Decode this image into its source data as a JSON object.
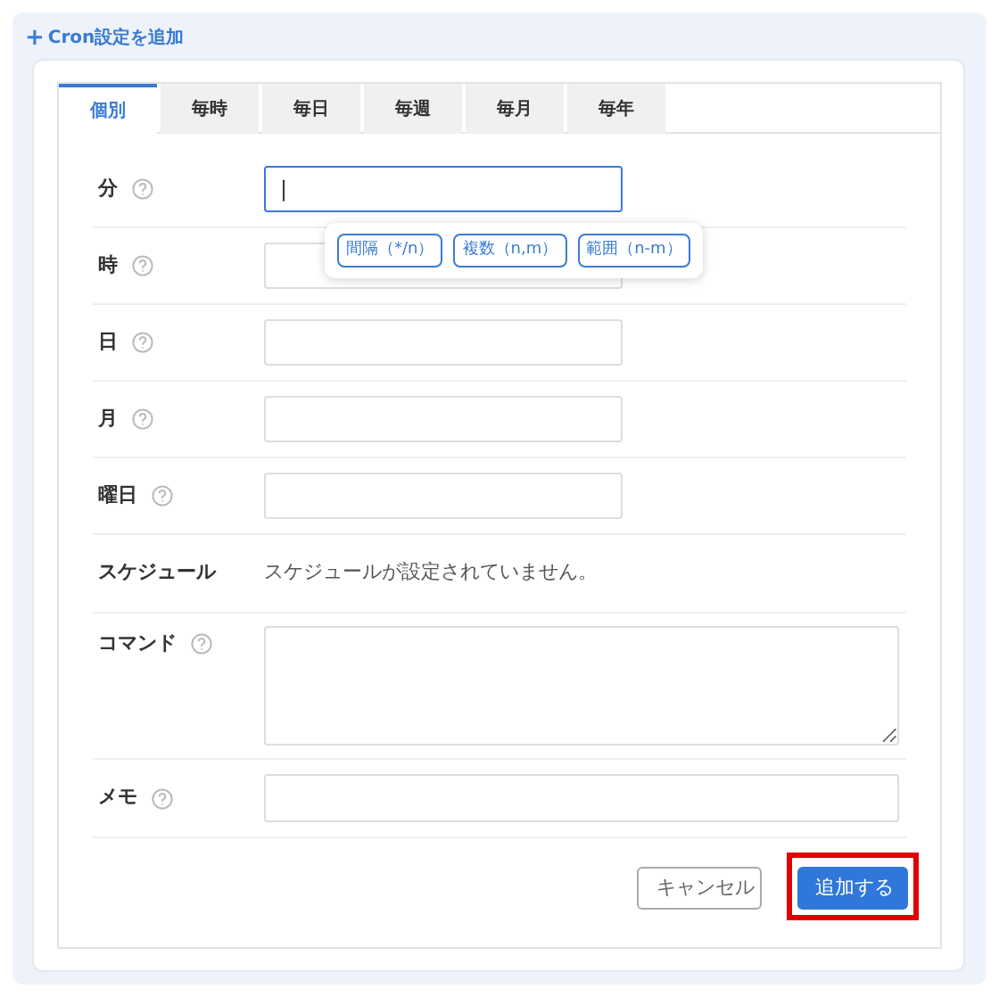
{
  "header": {
    "icon": "+",
    "title": "Cron設定を追加"
  },
  "tabs": [
    {
      "label": "個別",
      "selected": true
    },
    {
      "label": "毎時",
      "selected": false
    },
    {
      "label": "毎日",
      "selected": false
    },
    {
      "label": "毎週",
      "selected": false
    },
    {
      "label": "毎月",
      "selected": false
    },
    {
      "label": "毎年",
      "selected": false
    }
  ],
  "rows": [
    {
      "kind": "input",
      "label": "分",
      "help": true,
      "focused": true,
      "value": "|"
    },
    {
      "kind": "input",
      "label": "時",
      "help": true,
      "focused": false
    },
    {
      "kind": "input",
      "label": "日",
      "help": true,
      "focused": false
    },
    {
      "kind": "input",
      "label": "月",
      "help": true,
      "focused": false
    },
    {
      "kind": "input",
      "label": "曜日",
      "help": true,
      "focused": false
    },
    {
      "kind": "static",
      "label": "スケジュール",
      "help": false,
      "text": "スケジュールが設定されていません。"
    },
    {
      "kind": "textarea",
      "label": "コマンド",
      "help": true,
      "focused": false
    },
    {
      "kind": "wide",
      "label": "メモ",
      "help": true,
      "focused": false
    }
  ],
  "suggestions": [
    "間隔（*/n）",
    "複数（n,m）",
    "範囲（n-m）"
  ],
  "buttons": [
    {
      "label": "キャンセル",
      "kind": "secondary",
      "highlighted": false
    },
    {
      "label": "追加する",
      "kind": "primary",
      "highlighted": true
    }
  ]
}
